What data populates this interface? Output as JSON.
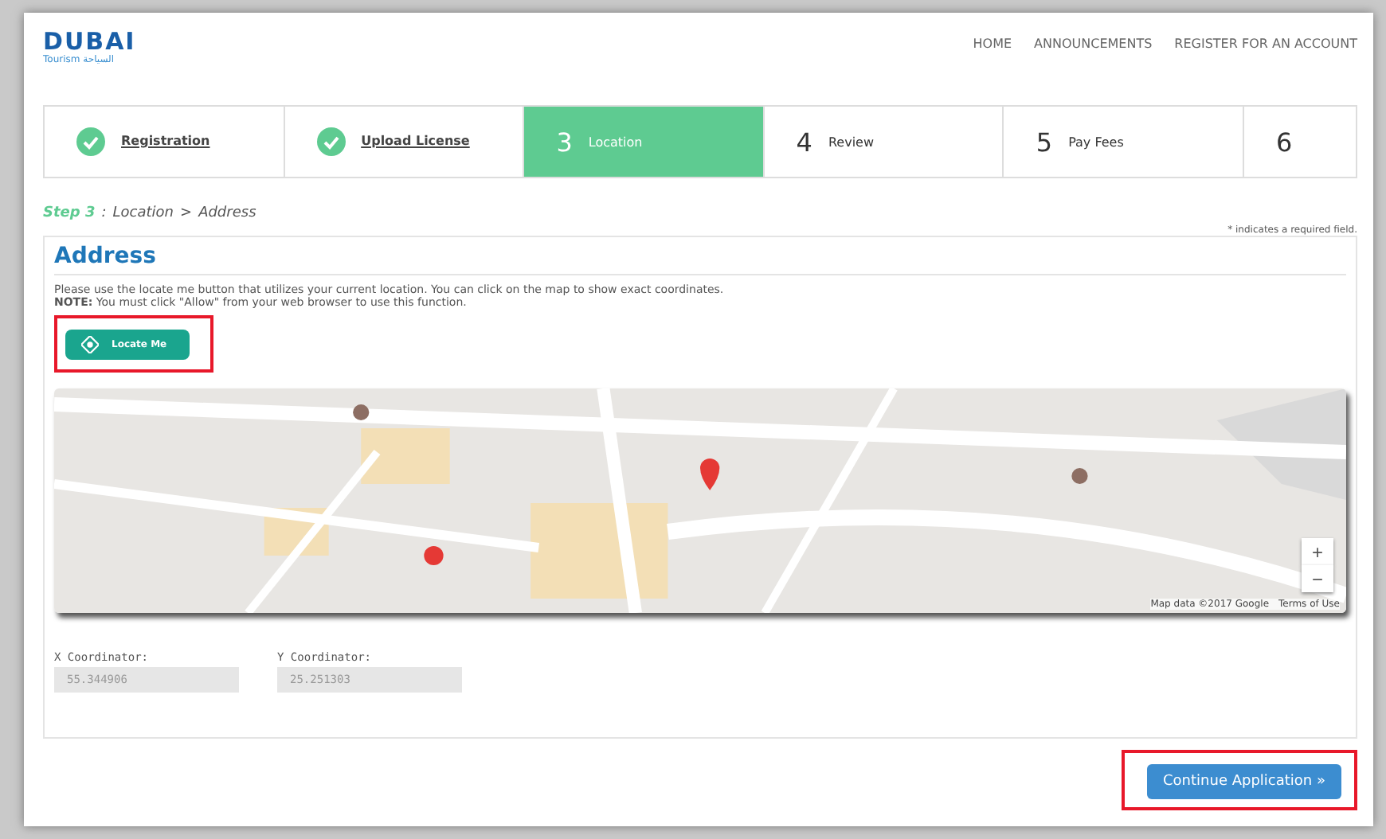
{
  "header": {
    "logo": "DUBAI",
    "logo_sub": "Tourism السياحة",
    "nav": [
      "HOME",
      "ANNOUNCEMENTS",
      "REGISTER FOR AN ACCOUNT"
    ]
  },
  "steps": [
    {
      "label": "Registration",
      "done": true,
      "selected": false
    },
    {
      "label": "Upload License",
      "done": true,
      "selected": false
    },
    {
      "number": "3",
      "label": "Location",
      "done": false,
      "selected": true
    },
    {
      "number": "4",
      "label": "Review",
      "done": false,
      "selected": false
    },
    {
      "number": "5",
      "label": "Pay Fees",
      "done": false,
      "selected": false
    },
    {
      "number": "6",
      "done": false,
      "selected": false
    }
  ],
  "breadcrumb": {
    "step": "Step 3",
    "sep1": ":",
    "location": "Location",
    "sep2": ">",
    "page": "Address"
  },
  "required_note": "* indicates a required field.",
  "section": {
    "title": "Address",
    "text": "Please use the locate me button that utilizes your current location. You can click on the map to show exact coordinates.",
    "note": "**NOTE:** You must click \"Allow\" from your web browser to use this function.",
    "locate_button": {
      "label": "Locate Me",
      "highlighted": true
    }
  },
  "map": {
    "kind": "picture",
    "zoom_in": "+",
    "zoom_out": "−",
    "attribution": "Map data ©2017 Google",
    "terms": "Terms of Use"
  },
  "fields": [
    {
      "label": "X Coordinator:",
      "value": "55.344906",
      "disabled": true
    },
    {
      "label": "Y Coordinator:",
      "value": "25.251303",
      "disabled": true
    }
  ],
  "continue_button": {
    "label": "Continue Application »",
    "highlighted": true
  }
}
